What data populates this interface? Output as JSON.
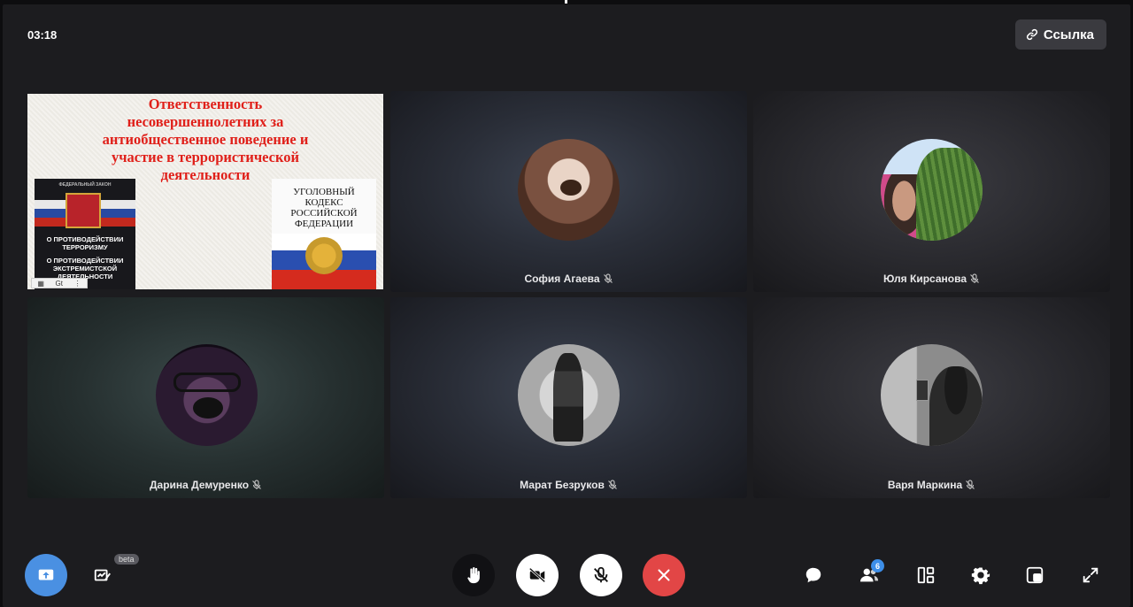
{
  "header": {
    "timer": "03:18",
    "link_label": "Ссылка"
  },
  "shared_screen": {
    "title_lines": [
      "Ответственность",
      "несовершеннолетних за",
      "антиобщественное поведение и",
      "участие в террористической",
      "деятельности"
    ],
    "book_left_lines": [
      "ФЕДЕРАЛЬНЫЙ ЗАКОН",
      "О ПРОТИВОДЕЙСТВИИ",
      "ТЕРРОРИЗМУ",
      "О ПРОТИВОДЕЙСТВИИ",
      "ЭКСТРЕМИСТСКОЙ",
      "ДЕЯТЕЛЬНОСТИ"
    ],
    "book_right_lines": [
      "УГОЛОВНЫЙ",
      "КОДЕКС",
      "РОССИЙСКОЙ",
      "ФЕДЕРАЦИИ"
    ],
    "mini_bar_label": "Gt"
  },
  "participants": [
    {
      "name": "София Агаева",
      "muted": true
    },
    {
      "name": "Юля Кирсанова",
      "muted": true
    },
    {
      "name": "Дарина Демуренко",
      "muted": true
    },
    {
      "name": "Марат Безруков",
      "muted": true
    },
    {
      "name": "Варя Маркина",
      "muted": true
    }
  ],
  "toolbar": {
    "beta_label": "beta",
    "participants_count": "6"
  },
  "colors": {
    "accent": "#3d8ee8",
    "end_call": "#e24646",
    "tile_bg": "#1c1c1f"
  },
  "icons": [
    "link-icon",
    "muted-mic-icon",
    "share-screen-icon",
    "whiteboard-icon",
    "raise-hand-icon",
    "camera-off-icon",
    "mic-off-icon",
    "end-call-icon",
    "chat-icon",
    "participants-icon",
    "layout-icon",
    "settings-icon",
    "pip-icon",
    "fullscreen-icon"
  ]
}
